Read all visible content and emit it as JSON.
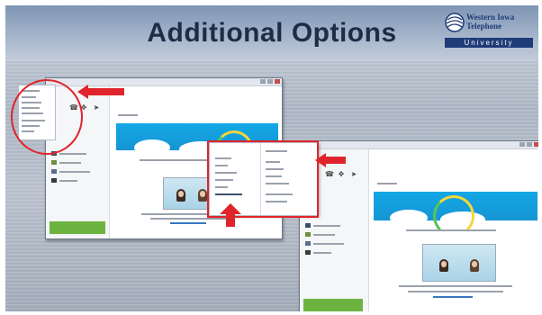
{
  "slide": {
    "title": "Additional Options",
    "logo": {
      "name_line1": "Western Iowa",
      "name_line2": "Telephone",
      "sub": "University",
      "icon": "globe-lines-icon"
    }
  },
  "windows": {
    "left_menu_icon": "skype-app-menu",
    "middle_menu_icon": "context-menu-popup",
    "banner_colors": {
      "sky": "#1aa3e4",
      "cloud": "#ffffff",
      "call_green": "#6db33f"
    },
    "highlight_color": "#e0242b"
  }
}
